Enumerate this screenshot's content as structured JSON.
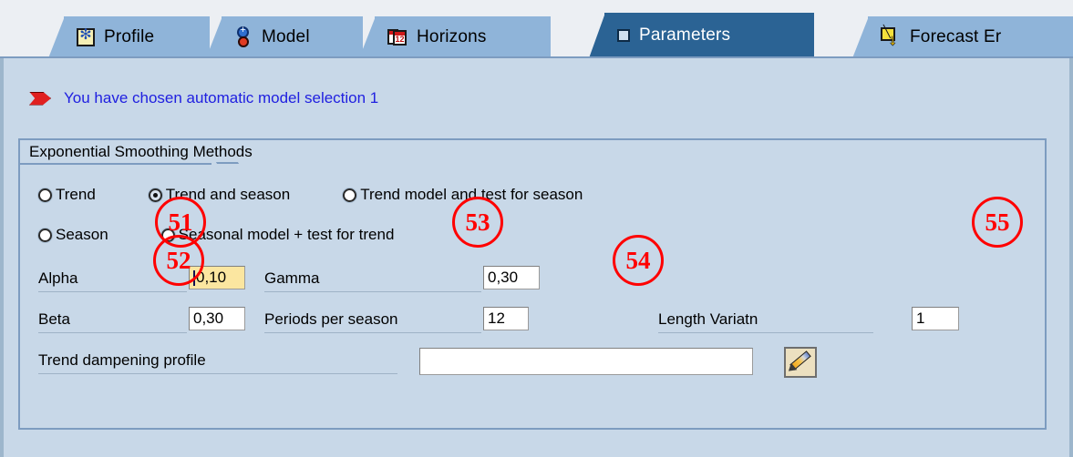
{
  "window": {
    "active_tab": "Parameters"
  },
  "tabs": [
    {
      "label": "Profile",
      "icon": "profile-icon",
      "active": false
    },
    {
      "label": "Model",
      "icon": "model-gear-icon",
      "active": false
    },
    {
      "label": "Horizons",
      "icon": "calendar-12-icon",
      "active": false
    },
    {
      "label": "Parameters",
      "icon": "parameters-square-icon",
      "active": true
    },
    {
      "label": "Forecast Er",
      "icon": "forecast-error-icon",
      "active": false
    }
  ],
  "message": {
    "icon": "red-arrow-flag-icon",
    "text": "You have chosen automatic model selection 1",
    "color": "#2020e0"
  },
  "groupbox": {
    "title": "Exponential Smoothing Methods"
  },
  "radios": [
    {
      "label": "Trend",
      "checked": false,
      "annotation": "51"
    },
    {
      "label": "Trend and season",
      "checked": true,
      "annotation": "53"
    },
    {
      "label": "Trend model and test for season",
      "checked": false,
      "annotation": "55"
    },
    {
      "label": "Season",
      "checked": false,
      "annotation": "52"
    },
    {
      "label": "Seasonal model + test for trend",
      "checked": false,
      "annotation": "54"
    }
  ],
  "fields": {
    "alpha": {
      "label": "Alpha",
      "value": "0,10",
      "focused": true
    },
    "gamma": {
      "label": "Gamma",
      "value": "0,30",
      "focused": false
    },
    "beta": {
      "label": "Beta",
      "value": "0,30",
      "focused": false
    },
    "periods_per_season": {
      "label": "Periods per season",
      "value": "12",
      "focused": false
    },
    "length_variatn": {
      "label": "Length Variatn",
      "value": "1",
      "focused": false
    },
    "trend_dampening": {
      "label": "Trend dampening profile",
      "value": "",
      "focused": false
    }
  },
  "buttons": {
    "trend_dampening_edit": {
      "icon": "pencil-icon",
      "label": ""
    }
  },
  "colors": {
    "tab_inactive": "#8fb4d9",
    "tab_active": "#2b6394",
    "panel": "#c8d8e8",
    "annotation": "#ff0000",
    "message_text": "#2020e0",
    "focused_field": "#fbe6a0"
  }
}
